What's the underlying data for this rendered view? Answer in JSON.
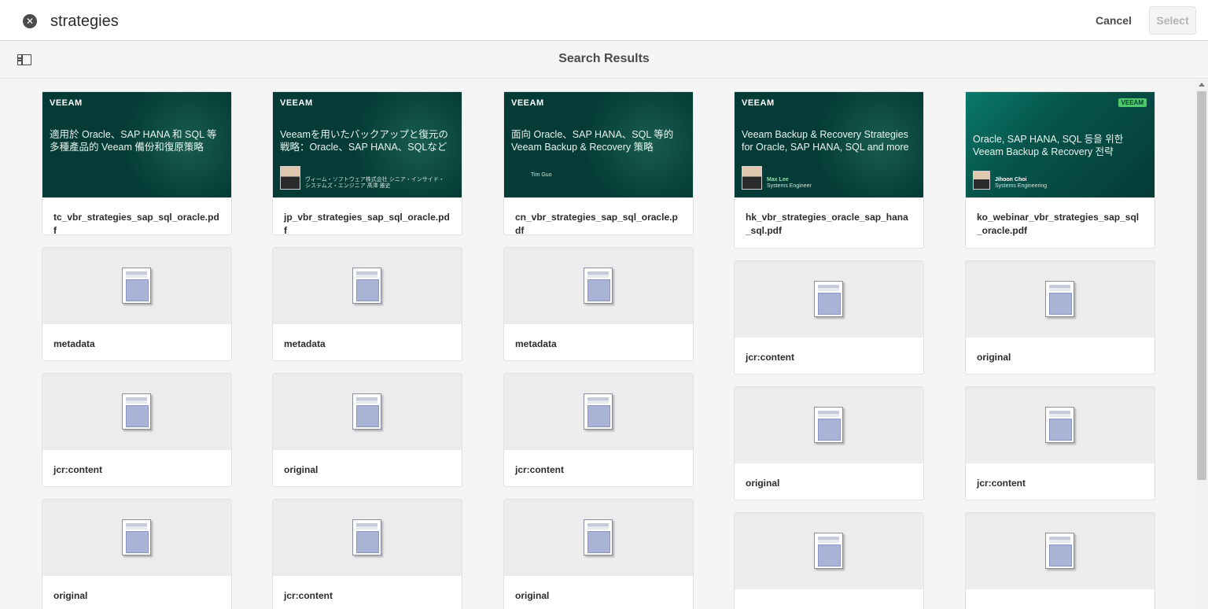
{
  "search": {
    "query": "strategies",
    "cancel_label": "Cancel",
    "select_label": "Select"
  },
  "header": {
    "title": "Search Results"
  },
  "thumbs": {
    "brand": "VEEAM",
    "tc": {
      "title": "適用於 Oracle、SAP HANA 和 SQL 等多種產品的 Veeam 備份和復原策略"
    },
    "jp": {
      "title": "Veeamを用いたバックアップと復元の戦略：Oracle、SAP HANA、SQLなど",
      "speaker": "ヴィーム・ソフトウェア株式会社 シニア・インサイド・システムズ・エンジニア 髙澤 雅史"
    },
    "cn": {
      "title": "面向 Oracle、SAP HANA、SQL 等的 Veeam Backup & Recovery 策略",
      "speaker": "Tim Guo"
    },
    "hk": {
      "title": "Veeam Backup & Recovery Strategies for Oracle, SAP HANA, SQL and more",
      "speaker_name": "Max Lee",
      "speaker_role": "Systems Engineer"
    },
    "ko": {
      "title": "Oracle, SAP HANA, SQL 등을 위한 Veeam Backup & Recovery 전략",
      "speaker_name": "Jihoon Choi",
      "speaker_role": "Systems Engineering"
    }
  },
  "columns": [
    {
      "items": [
        "tc_vbr_strategies_sap_sql_oracle.pdf",
        "metadata",
        "jcr:content",
        "original"
      ]
    },
    {
      "items": [
        "jp_vbr_strategies_sap_sql_oracle.pdf",
        "metadata",
        "original",
        "jcr:content"
      ]
    },
    {
      "items": [
        "cn_vbr_strategies_sap_sql_oracle.pdf",
        "metadata",
        "jcr:content",
        "original"
      ]
    },
    {
      "items": [
        "hk_vbr_strategies_oracle_sap_hana_sql.pdf",
        "jcr:content",
        "original",
        ""
      ]
    },
    {
      "items": [
        "ko_webinar_vbr_strategies_sap_sql_oracle.pdf",
        "original",
        "jcr:content",
        ""
      ]
    }
  ],
  "icons": {
    "clear": "close-circle-icon",
    "rail": "rail-toggle-icon",
    "doc": "document-icon"
  }
}
